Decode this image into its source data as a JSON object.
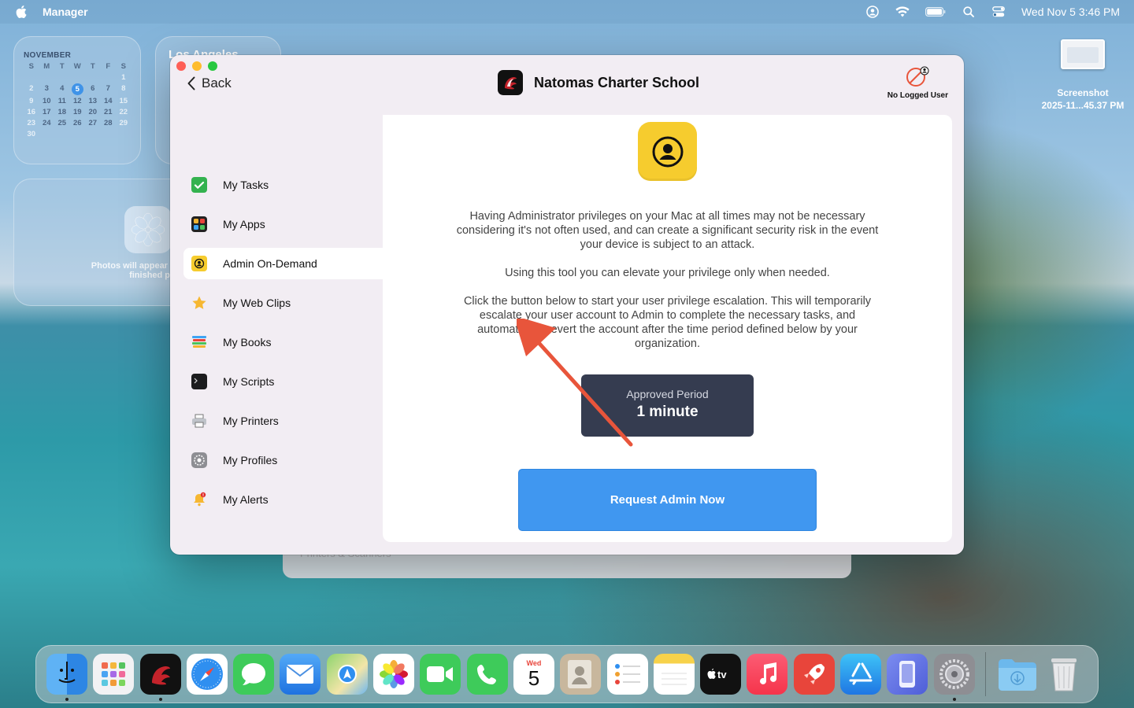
{
  "menubar": {
    "app_name": "Manager",
    "datetime": "Wed Nov 5  3:46 PM",
    "icons": [
      "apple-icon",
      "user-status-icon",
      "wifi-icon",
      "battery-icon",
      "spotlight-icon",
      "control-center-icon"
    ]
  },
  "widgets": {
    "calendar": {
      "month": "NOVEMBER",
      "weekdays": [
        "S",
        "M",
        "T",
        "W",
        "T",
        "F",
        "S"
      ],
      "today": "5"
    },
    "weather": {
      "city": "Los Angeles"
    },
    "photos": {
      "text": "Photos will appear here once finished processing"
    }
  },
  "desktop": {
    "screenshot_label_line1": "Screenshot",
    "screenshot_label_line2": "2025-11...45.37 PM"
  },
  "background_window": {
    "text": "Printers & Scanners"
  },
  "window": {
    "back_label": "Back",
    "org_name": "Natomas Charter School",
    "user_status": "No Logged User",
    "sidebar": [
      {
        "label": "My Tasks",
        "icon": "checkbox-icon"
      },
      {
        "label": "My Apps",
        "icon": "apps-grid-icon"
      },
      {
        "label": "Admin On-Demand",
        "icon": "admin-user-icon",
        "active": true
      },
      {
        "label": "My Web Clips",
        "icon": "star-icon"
      },
      {
        "label": "My Books",
        "icon": "books-icon"
      },
      {
        "label": "My Scripts",
        "icon": "terminal-icon"
      },
      {
        "label": "My Printers",
        "icon": "printer-icon"
      },
      {
        "label": "My Profiles",
        "icon": "profile-gear-icon"
      },
      {
        "label": "My Alerts",
        "icon": "bell-icon"
      }
    ],
    "content": {
      "para1": "Having Administrator privileges on your Mac at all times may not be necessary considering it's not often used, and can create a significant security risk in the event your device is subject to an attack.",
      "para2": "Using this tool you can elevate your privilege only when needed.",
      "para3": "Click the button below to start your user privilege escalation. This will temporarily escalate your user account to Admin to complete the necessary tasks, and automatically revert the account after the time period defined below by your organization.",
      "period_label": "Approved Period",
      "period_value": "1 minute",
      "request_button": "Request Admin Now"
    }
  },
  "dock": {
    "calendar_day": "Wed",
    "calendar_date": "5",
    "apps": [
      "finder",
      "launchpad",
      "self-service",
      "safari",
      "messages",
      "mail",
      "maps",
      "photos",
      "facetime",
      "phone",
      "calendar",
      "contacts",
      "reminders",
      "notes",
      "apple-tv",
      "music",
      "rocket",
      "app-store",
      "iphone-mirroring",
      "system-settings",
      "downloads",
      "trash"
    ]
  },
  "colors": {
    "accent_blue": "#4097f0",
    "period_bg": "#353c50",
    "arrow": "#e8553b",
    "admin_icon_yellow": "#f6cc2e"
  }
}
